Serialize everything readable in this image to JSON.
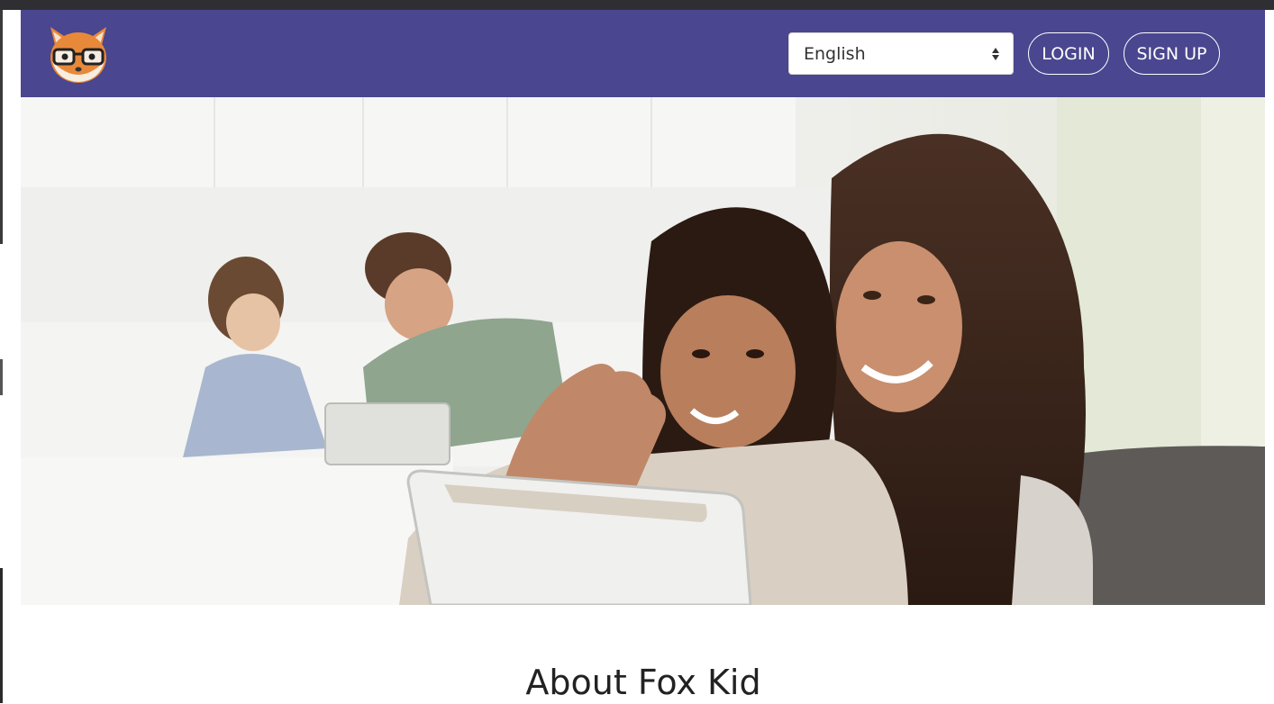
{
  "header": {
    "background": "#4a468f",
    "logo_icon": "fox-with-glasses-icon",
    "language_select": {
      "selected": "English"
    },
    "login_label": "LOGIN",
    "signup_label": "SIGN UP"
  },
  "hero": {
    "image": "family-with-tablets-photo"
  },
  "about": {
    "title": "About Fox Kid"
  }
}
